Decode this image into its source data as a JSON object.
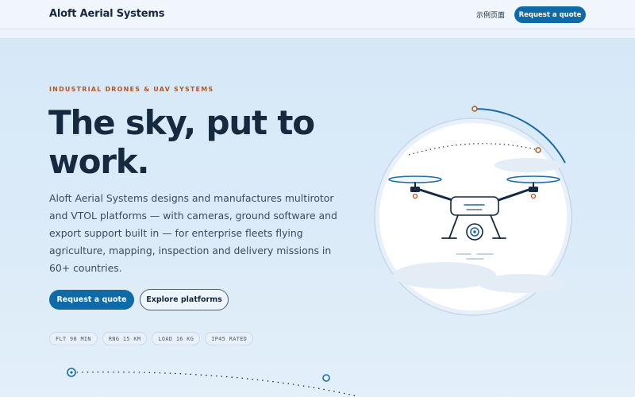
{
  "header": {
    "brand": "Aloft Aerial Systems",
    "nav_link": "示例页面",
    "cta_label": "Request a quote"
  },
  "hero": {
    "eyebrow": "INDUSTRIAL DRONES & UAV SYSTEMS",
    "headline_line1": "The sky, put to",
    "headline_line2": "work.",
    "description": "Aloft Aerial Systems designs and manufactures multirotor and VTOL platforms — with cameras, ground software and export support built in — for enterprise fleets flying agriculture, mapping, inspection and delivery missions in 60+ countries.",
    "primary_cta": "Request a quote",
    "secondary_cta": "Explore platforms",
    "specs": [
      "FLT 90 MIN",
      "RNG 15 KM",
      "LOAD 16 KG",
      "IP45 RATED"
    ]
  },
  "colors": {
    "primary": "#0f6aa8",
    "heading": "#15293f",
    "accent": "#b8541f",
    "background": "#dcebf8"
  },
  "illustration": {
    "subject": "drone-icon"
  }
}
